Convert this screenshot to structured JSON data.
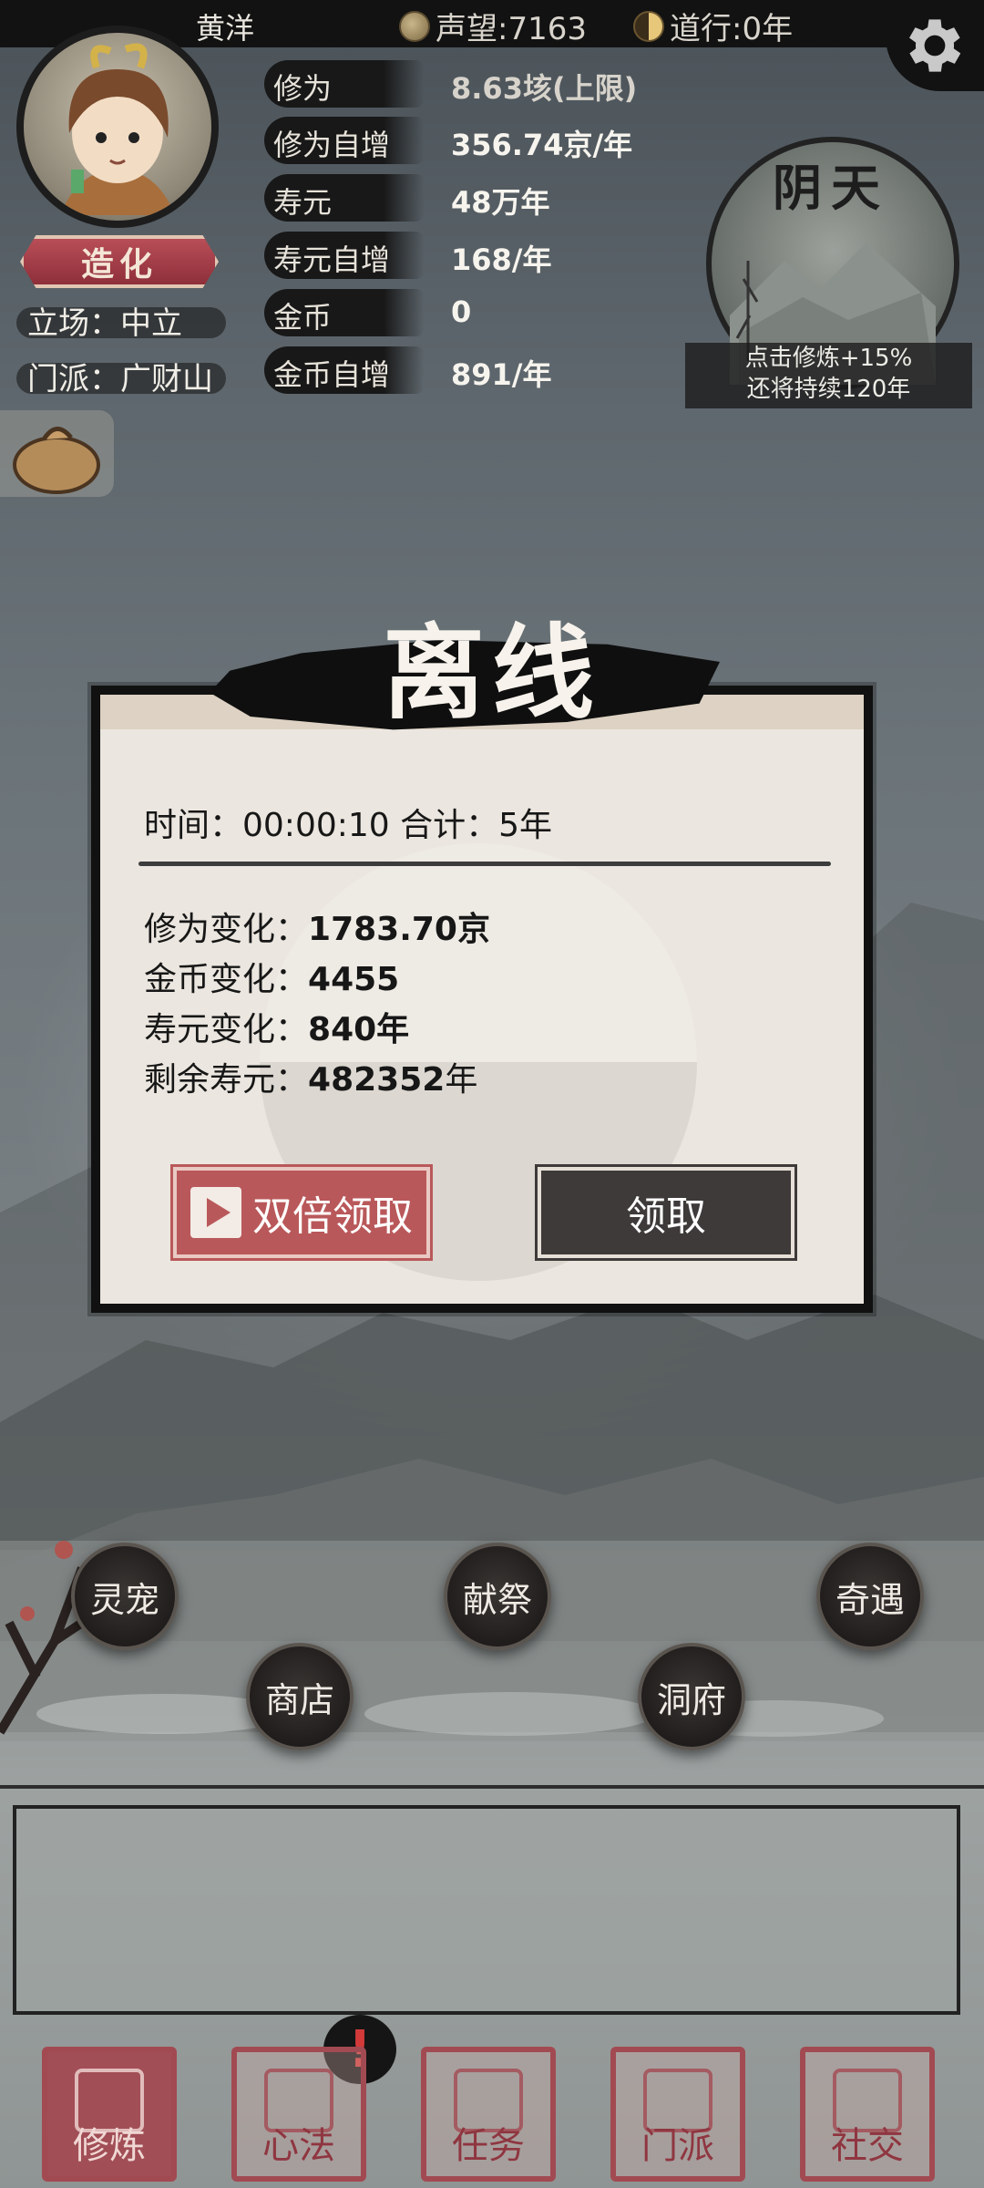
{
  "topbar": {
    "player_name": "黄洋",
    "reputation": "声望:7163",
    "dao_practice": "道行:0年",
    "reputation_icon": "coin-icon",
    "dao_icon": "taiji-icon",
    "settings_icon": "gear-icon"
  },
  "profile": {
    "rank": "造化",
    "stance": "立场：中立",
    "sect": "门派：广财山"
  },
  "stats": [
    {
      "label": "修为",
      "value": "8.63垓(上限)"
    },
    {
      "label": "修为自增",
      "value": "356.74京/年"
    },
    {
      "label": "寿元",
      "value": "48万年"
    },
    {
      "label": "寿元自增",
      "value": "168/年"
    },
    {
      "label": "金币",
      "value": "0"
    },
    {
      "label": "金币自增",
      "value": "891/年"
    }
  ],
  "weather": {
    "title": "阴天",
    "line1": "点击修炼+15%",
    "line2": "还将持续120年"
  },
  "dialog": {
    "title": "离线",
    "time_line": "时间：00:00:10  合计：5年",
    "rows": [
      {
        "label": "修为变化：",
        "value": "1783.70京",
        "suffix": ""
      },
      {
        "label": "金币变化：",
        "value": "4455",
        "suffix": ""
      },
      {
        "label": "寿元变化：",
        "value": "840年",
        "suffix": ""
      },
      {
        "label": "剩余寿元：",
        "value": "482352",
        "suffix": "年"
      }
    ],
    "double_button": "双倍领取",
    "claim_button": "领取"
  },
  "map_buttons": [
    "灵宠",
    "献祭",
    "奇遇",
    "商店",
    "洞府"
  ],
  "nav": [
    "修炼",
    "心法",
    "任务",
    "门派",
    "社交"
  ],
  "alert_symbol": "!",
  "colors": {
    "accent_red": "#b9585a",
    "dark_button": "#3d3a39",
    "nav_red": "#a24a52"
  }
}
